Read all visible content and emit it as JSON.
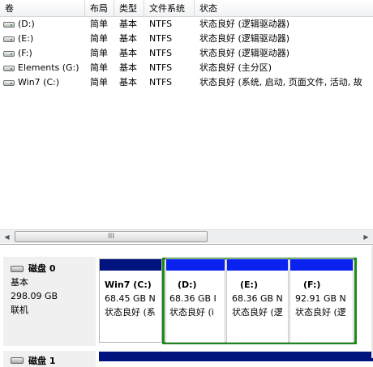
{
  "columns": [
    "卷",
    "布局",
    "类型",
    "文件系统",
    "状态"
  ],
  "volumes": [
    {
      "name": "(D:)",
      "layout": "简单",
      "type": "基本",
      "fs": "NTFS",
      "status": "状态良好 (逻辑驱动器)"
    },
    {
      "name": "(E:)",
      "layout": "简单",
      "type": "基本",
      "fs": "NTFS",
      "status": "状态良好 (逻辑驱动器)"
    },
    {
      "name": "(F:)",
      "layout": "简单",
      "type": "基本",
      "fs": "NTFS",
      "status": "状态良好 (逻辑驱动器)"
    },
    {
      "name": "Elements (G:)",
      "layout": "简单",
      "type": "基本",
      "fs": "NTFS",
      "status": "状态良好 (主分区)"
    },
    {
      "name": "Win7 (C:)",
      "layout": "简单",
      "type": "基本",
      "fs": "NTFS",
      "status": "状态良好 (系统, 启动, 页面文件, 活动, 故"
    }
  ],
  "scrollbar": {
    "thumb_glyph": "III",
    "left_glyph": "◀",
    "right_glyph": "▶"
  },
  "disk0": {
    "name": "磁盘 0",
    "type": "基本",
    "size": "298.09 GB",
    "state": "联机",
    "partitions": [
      {
        "name": "Win7  (C:)",
        "size": "68.45 GB N",
        "status": "状态良好 (系",
        "bar": "dark"
      },
      {
        "name": "(D:)",
        "size": "68.36 GB I",
        "status": "状态良好 (ì",
        "bar": "blue"
      },
      {
        "name": "(E:)",
        "size": "68.36 GB N",
        "status": "状态良好 (逻",
        "bar": "blue"
      },
      {
        "name": "(F:)",
        "size": "92.91 GB N",
        "status": "状态良好 (逻",
        "bar": "blue"
      }
    ]
  },
  "disk1": {
    "name": "磁盘 1"
  },
  "colors": {
    "primary_partition": "#00137f",
    "logical_drive": "#0a22f0",
    "extended_partition": "#1b8a1b"
  }
}
